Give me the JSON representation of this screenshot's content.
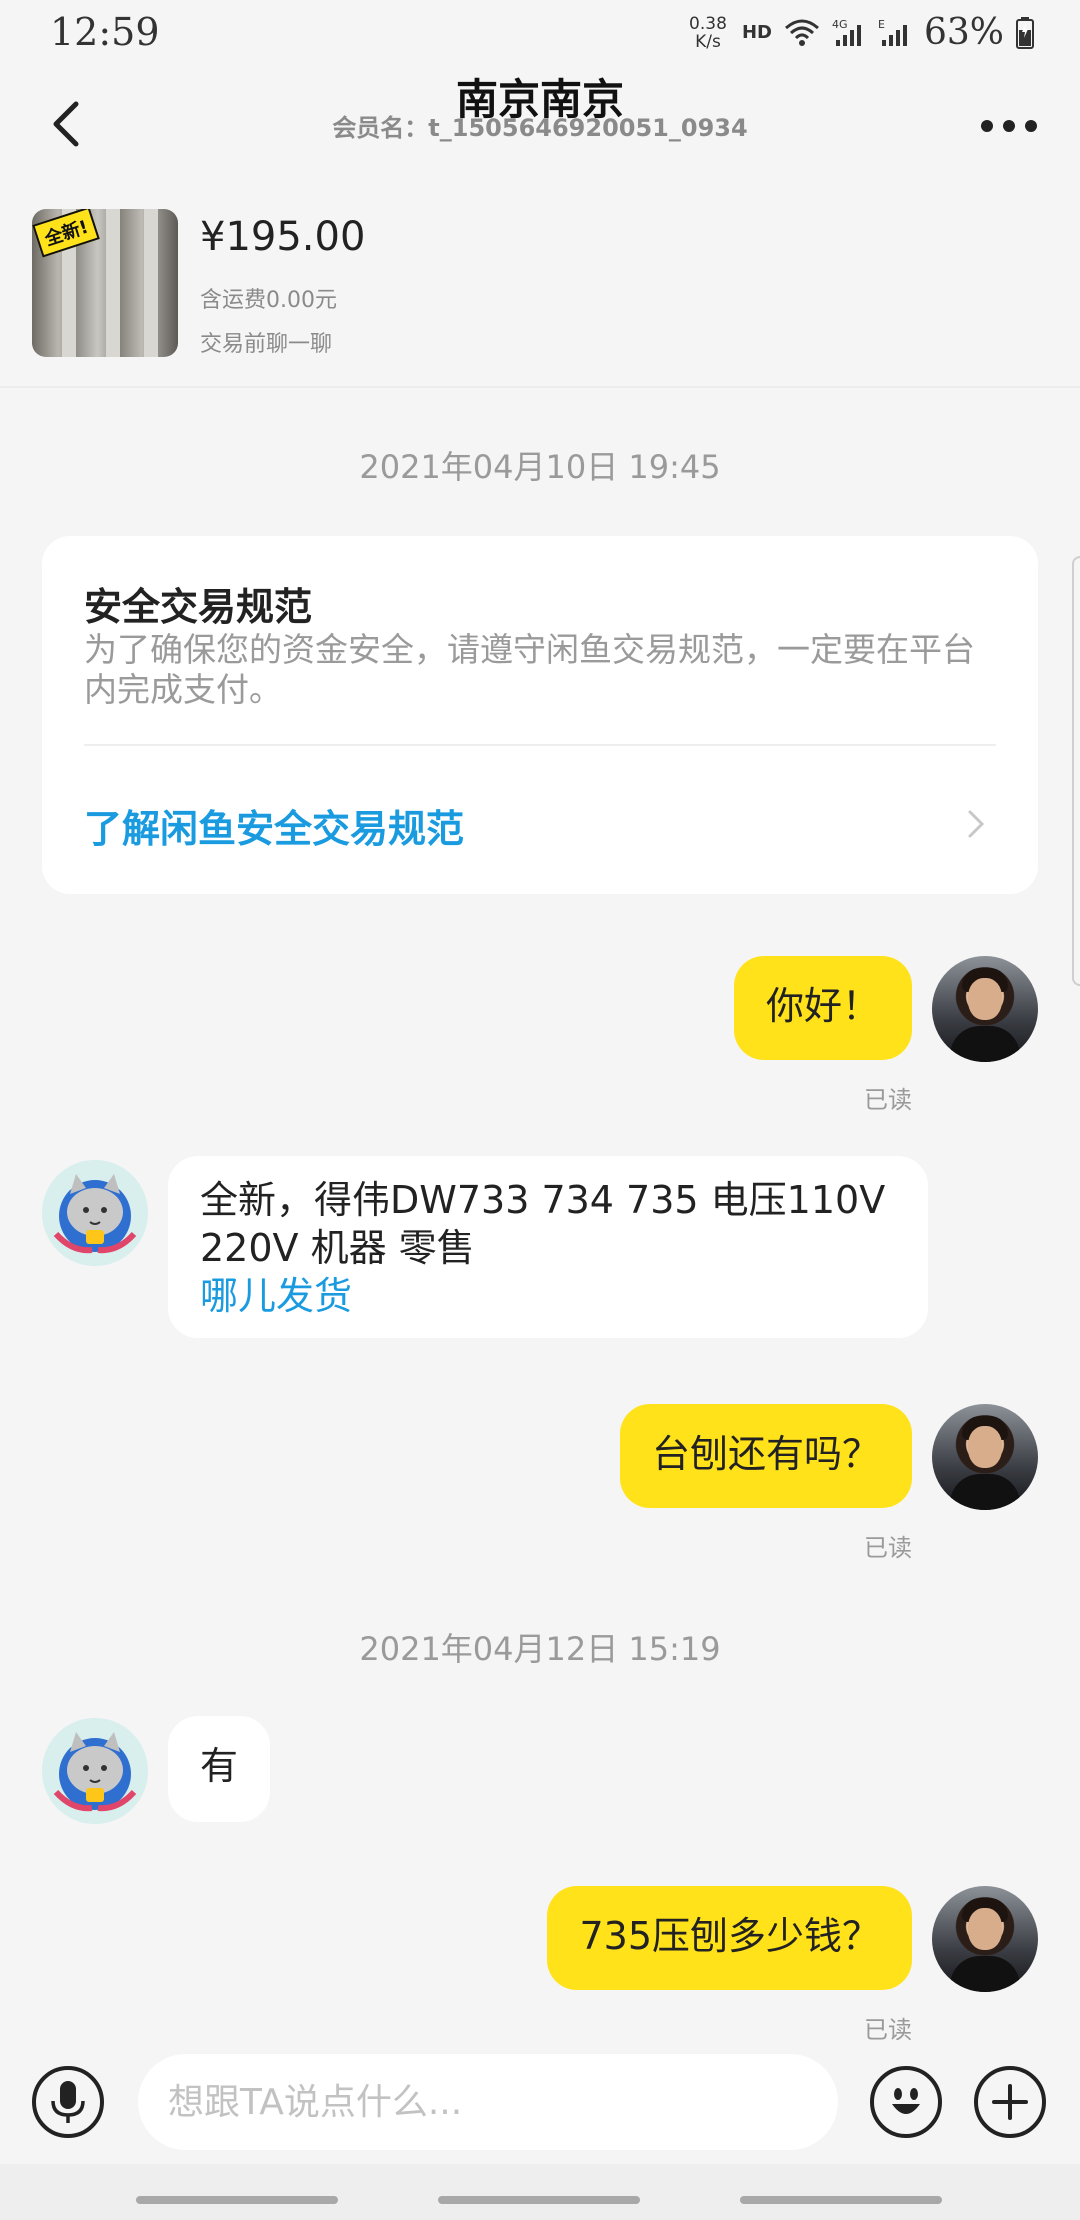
{
  "status_bar": {
    "time": "12:59",
    "net_speed": "0.38",
    "net_unit": "K/s",
    "hd": "HD",
    "network": "4G",
    "network_sub": "E",
    "battery": "63%"
  },
  "header": {
    "title": "南京南京",
    "member": "会员名：t_1505646920051_0934"
  },
  "product": {
    "badge": "全新!",
    "price": "¥195.00",
    "shipping": "含运费0.00元",
    "chat_hint": "交易前聊一聊"
  },
  "messages": {
    "ts1": "2021年04月10日 19:45",
    "ts2": "2021年04月12日 15:19",
    "safety_title": "安全交易规范",
    "safety_desc": "为了确保您的资金安全，请遵守闲鱼交易规范，一定要在平台内完成支付。",
    "safety_link": "了解闲鱼安全交易规范",
    "m1": "你好！",
    "m2_line1": "全新，得伟DW733 734 735 电压110V",
    "m2_line2": "220V 机器  零售",
    "m2_link": "哪儿发货",
    "m3": "台刨还有吗？",
    "m4": "有",
    "m5": "735压刨多少钱？",
    "read": "已读"
  },
  "input": {
    "placeholder": "想跟TA说点什么..."
  },
  "colors": {
    "accent_yellow": "#ffe21a",
    "link_blue": "#1a9be0",
    "bg": "#f5f5f5"
  }
}
